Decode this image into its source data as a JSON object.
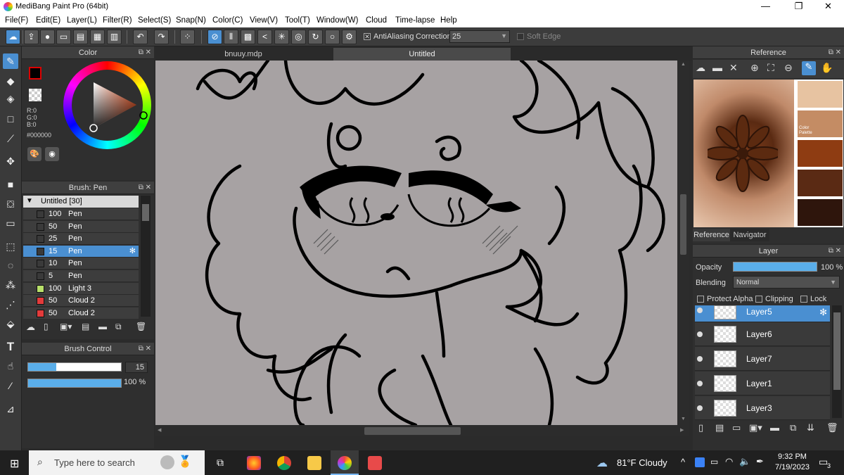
{
  "window": {
    "title": "MediBang Paint Pro (64bit)",
    "minimize": "—",
    "restore": "❐",
    "close": "✕"
  },
  "menu": [
    "File(F)",
    "Edit(E)",
    "Layer(L)",
    "Filter(R)",
    "Select(S)",
    "Snap(N)",
    "Color(C)",
    "View(V)",
    "Tool(T)",
    "Window(W)",
    "Cloud",
    "Time-lapse",
    "Help"
  ],
  "toolbar": {
    "antialiasing_label": "AntiAliasing",
    "antialiasing_checked": "✕",
    "correction_label": "Correction",
    "correction_value": "25",
    "softedge_label": "Soft Edge"
  },
  "color_panel": {
    "title": "Color",
    "r": "R:0",
    "g": "G:0",
    "b": "B:0",
    "hex": "#000000",
    "primary_color": "#000000",
    "secondary_color": "#ffffff"
  },
  "brush_panel": {
    "title": "Brush: Pen",
    "group": "Untitled [30]",
    "items": [
      {
        "size": "100",
        "name": "Pen",
        "color": "#3a3a3a"
      },
      {
        "size": "50",
        "name": "Pen",
        "color": "#3a3a3a"
      },
      {
        "size": "25",
        "name": "Pen",
        "color": "#3a3a3a"
      },
      {
        "size": "15",
        "name": "Pen",
        "color": "#3a3a3a"
      },
      {
        "size": "10",
        "name": "Pen",
        "color": "#3a3a3a"
      },
      {
        "size": "5",
        "name": "Pen",
        "color": "#3a3a3a"
      },
      {
        "size": "100",
        "name": "Light 3",
        "color": "#b8e06a"
      },
      {
        "size": "50",
        "name": "Cloud 2",
        "color": "#e33b3b"
      },
      {
        "size": "50",
        "name": "Cloud 2",
        "color": "#e33b3b"
      }
    ],
    "selected_index": 3
  },
  "brush_control": {
    "title": "Brush Control",
    "size_value": "15",
    "size_fraction": 0.3,
    "opacity_label": "100 %",
    "opacity_fraction": 1.0
  },
  "tabs": [
    "bnuuy.mdp",
    "Untitled"
  ],
  "reference_panel": {
    "title": "Reference",
    "tabs": [
      "Reference",
      "Navigator"
    ],
    "palette_caption": "Color Palette",
    "palette": [
      "#e7c3a1",
      "#c48c64",
      "#8e3c12",
      "#5a2a14",
      "#2e150c"
    ]
  },
  "layer_panel": {
    "title": "Layer",
    "opacity_label": "Opacity",
    "opacity_value": "100 %",
    "opacity_fraction": 1.0,
    "blending_label": "Blending",
    "blending_value": "Normal",
    "protect_alpha": "Protect Alpha",
    "clipping": "Clipping",
    "lock": "Lock",
    "layers": [
      "Layer5",
      "Layer6",
      "Layer7",
      "Layer1",
      "Layer3"
    ],
    "selected_layer": "Layer5"
  },
  "taskbar": {
    "search_placeholder": "Type here to search",
    "weather": "81°F  Cloudy",
    "time": "9:32 PM",
    "date": "7/19/2023",
    "notifications": "3"
  }
}
